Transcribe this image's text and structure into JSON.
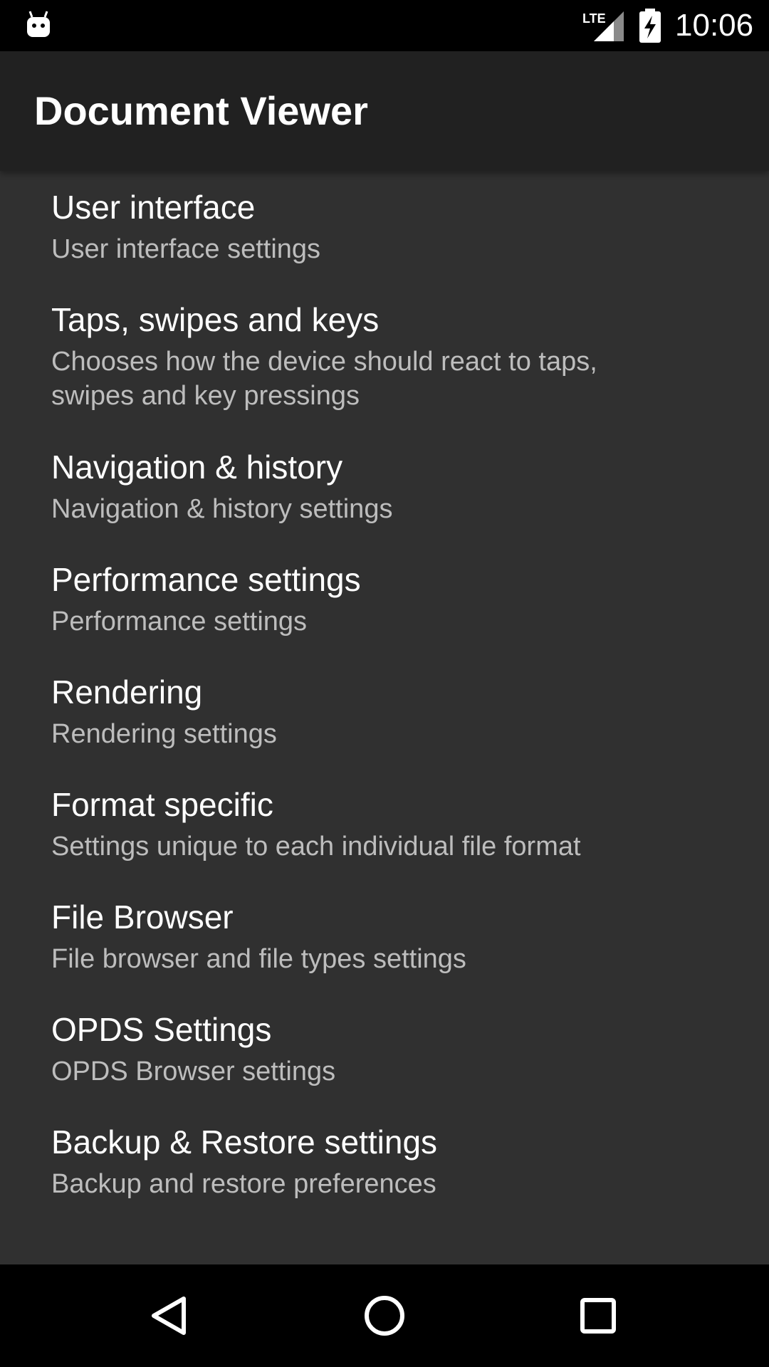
{
  "status_bar": {
    "time": "10:06",
    "app_icon": "android-debug-icon",
    "network": "LTE",
    "signal_icon": "signal-icon",
    "battery_icon": "battery-charging-icon"
  },
  "app_bar": {
    "title": "Document Viewer"
  },
  "settings": {
    "items": [
      {
        "title": "User interface",
        "summary": "User interface settings"
      },
      {
        "title": "Taps, swipes and keys",
        "summary": "Chooses how the device should react to taps, swipes and key pressings"
      },
      {
        "title": "Navigation & history",
        "summary": "Navigation & history settings"
      },
      {
        "title": "Performance settings",
        "summary": "Performance settings"
      },
      {
        "title": "Rendering",
        "summary": "Rendering settings"
      },
      {
        "title": "Format specific",
        "summary": "Settings unique to each individual file format"
      },
      {
        "title": "File Browser",
        "summary": "File browser and file types settings"
      },
      {
        "title": "OPDS Settings",
        "summary": "OPDS Browser settings"
      },
      {
        "title": "Backup & Restore settings",
        "summary": "Backup and restore preferences"
      }
    ]
  },
  "nav_bar": {
    "back_icon": "back-triangle-icon",
    "home_icon": "home-circle-icon",
    "recents_icon": "recents-square-icon"
  },
  "colors": {
    "status_bar": "#000000",
    "app_bar": "#212121",
    "background": "#303030",
    "title_text": "#ffffff",
    "summary_text": "#bdbdbd"
  }
}
